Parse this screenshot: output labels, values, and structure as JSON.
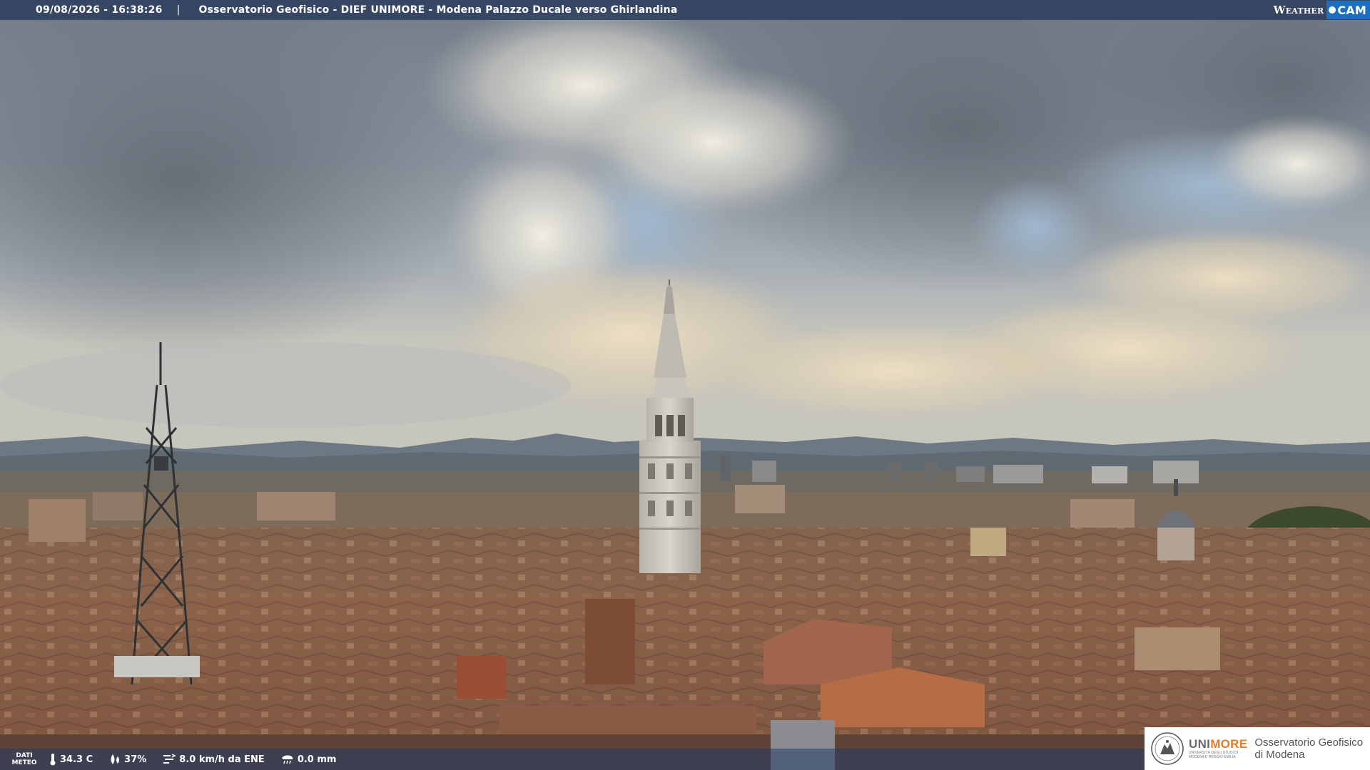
{
  "overlay": {
    "timestamp": "09/08/2026 - 16:38:26",
    "separator": "|",
    "caption": "Osservatorio Geofisico - DIEF UNIMORE - Modena Palazzo Ducale verso Ghirlandina"
  },
  "brand": {
    "word": "Weather",
    "cam": "CAM"
  },
  "weather": {
    "label_line1": "DATI",
    "label_line2": "METEO",
    "temperature": "34.3 C",
    "humidity": "37%",
    "wind": "8.0 km/h da ENE",
    "rain": "0.0 mm",
    "icons": {
      "temperature": "thermometer-icon",
      "humidity": "droplet-icon",
      "wind": "wind-icon",
      "rain": "rain-gauge-icon"
    }
  },
  "logo": {
    "uni_grey": "UNI",
    "uni_orange": "MORE",
    "uni_sub1": "UNIVERSITÀ DEGLI STUDI DI",
    "uni_sub2": "MODENA E REGGIO EMILIA",
    "obs_line1": "Osservatorio Geofisico",
    "obs_line2": "di Modena"
  },
  "colors": {
    "caption_bar": "#283a5c",
    "unimore_orange": "#e07b2a",
    "weathercam_blue": "#1a6fc2"
  }
}
